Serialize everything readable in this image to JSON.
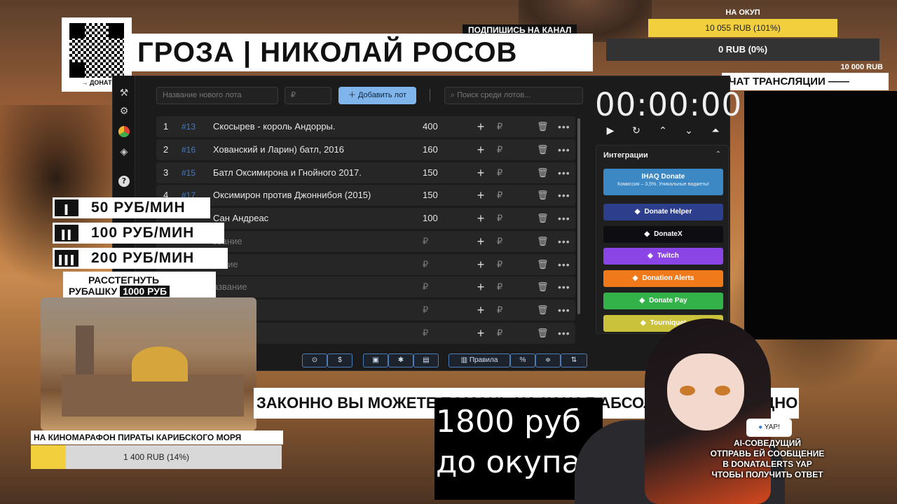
{
  "overlay": {
    "qr_label": "→ ДОНАТ",
    "title": "ГРОЗА | НИКОЛАЙ РОСОВ",
    "subscribe": "ПОДПИШИСЬ НА КАНАЛ",
    "goal_label": "НА ОКУП",
    "goal_progress": "10 055 RUB (101%)",
    "goal2_progress": "0 RUB (0%)",
    "goal2_amount": "10 000 RUB",
    "chat_label": "ЧАТ ТРАНСЛЯЦИИ ——",
    "rates": [
      {
        "badge": "I",
        "text": "50 РУБ/МИН"
      },
      {
        "badge": "II",
        "text": "100 РУБ/МИН"
      },
      {
        "badge": "III",
        "text": "200 РУБ/МИН"
      }
    ],
    "shirt_line1": "РАССТЕГНУТЬ",
    "shirt_line2": "РУБАШКУ",
    "shirt_price": "1000 РУБ",
    "movie_label": "НА КИНОМАРАФОН ПИРАТЫ КАРИБСКОГО МОРЯ",
    "movie_progress": "1 400 RUB (14%)",
    "movie_fill_fraction": 0.14,
    "ticker": "ЗАКОННО ВЫ МОЖЕТЕ ПОМОЧЬ НА КАНАЛ АБСОЛЮТНО СВОБОДНО",
    "big_line1": "1800 руб",
    "big_line2": "до окупа",
    "yap": "YAP!",
    "ai_lines": [
      "AI-СОВЕДУЩИЙ",
      "ОТПРАВЬ ЕЙ СООБЩЕНИЕ",
      "В DONATALERTS YAP",
      "ЧТОБЫ ПОЛУЧИТЬ ОТВЕТ"
    ]
  },
  "app": {
    "new_lot_placeholder": "Название нового лота",
    "price_placeholder": "₽",
    "add_button": "Добавить лот",
    "search_placeholder": "Поиск среди лотов...",
    "timer": "00:00:00",
    "lots": [
      {
        "num": "1",
        "id": "#13",
        "name": "Скосырев - король Андорры.",
        "amount": "400"
      },
      {
        "num": "2",
        "id": "#16",
        "name": "Хованский и Ларин) батл, 2016",
        "amount": "160"
      },
      {
        "num": "3",
        "id": "#15",
        "name": "Батл Оксимирона и Гнойного 2017.",
        "amount": "150"
      },
      {
        "num": "4",
        "id": "#17",
        "name": "Оксимирон против Джоннибоя (2015)",
        "amount": "150"
      },
      {
        "num": "",
        "id": "",
        "name": "Сан Андреас",
        "amount": "100"
      },
      {
        "num": "",
        "id": "",
        "name": "звание",
        "amount": "₽",
        "placeholder": true
      },
      {
        "num": "",
        "id": "",
        "name": "вание",
        "amount": "₽",
        "placeholder": true
      },
      {
        "num": "",
        "id": "",
        "name": "азвание",
        "amount": "₽",
        "placeholder": true
      },
      {
        "num": "",
        "id": "",
        "name": "",
        "amount": "₽",
        "placeholder": true
      },
      {
        "num": "",
        "id": "",
        "name": "",
        "amount": "₽",
        "placeholder": true
      }
    ],
    "integrations_title": "Интеграции",
    "integrations": [
      {
        "label": "IHAQ Donate",
        "sub": "Комиссия – 3,5%. Уникальные виджеты!",
        "color": "#3b88c5"
      },
      {
        "label": "Donate Helper",
        "color": "#2c3e8c"
      },
      {
        "label": "DonateX",
        "color": "#0e0e12"
      },
      {
        "label": "Twitch",
        "color": "#8b45e6"
      },
      {
        "label": "Donation Alerts",
        "color": "#f07a1a"
      },
      {
        "label": "Donate Pay",
        "color": "#33b24a"
      },
      {
        "label": "Tourniquet",
        "color": "#c9c23a"
      }
    ],
    "rules_label": "Правила"
  }
}
